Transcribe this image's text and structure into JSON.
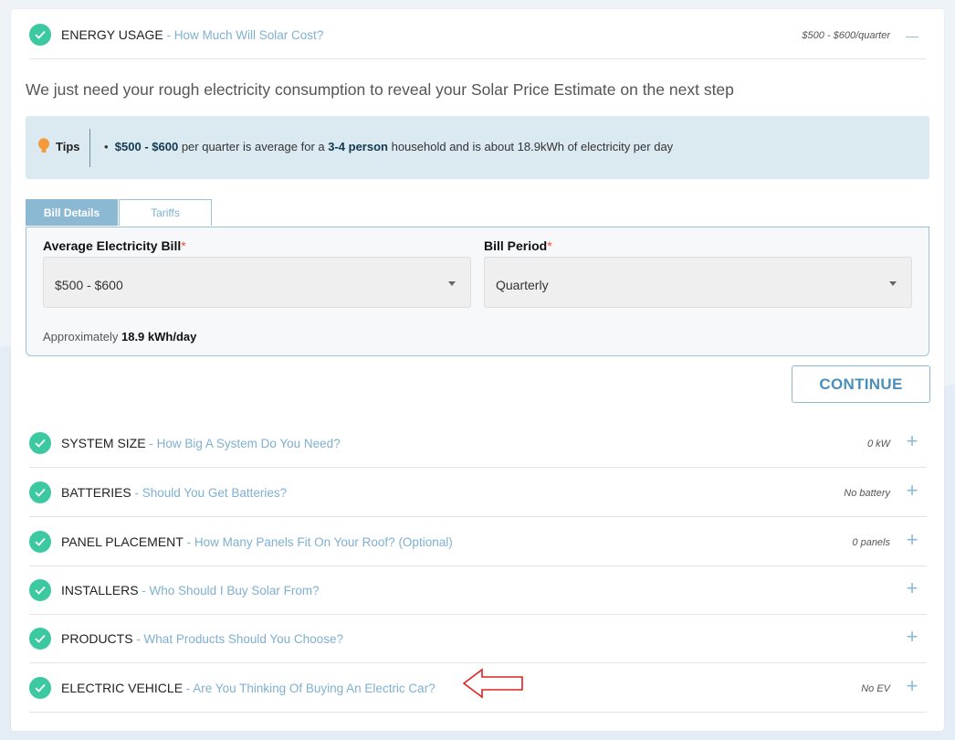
{
  "energy": {
    "title": "ENERGY USAGE",
    "subtitle": " - How Much Will Solar Cost?",
    "value": "$500 - $600/quarter",
    "toggle": "—",
    "intro": "We just need your rough electricity consumption to reveal your Solar Price Estimate on the next step"
  },
  "tips": {
    "label": "Tips",
    "bullet": "•",
    "price": "$500 - $600",
    "text_1": " per quarter is average for a ",
    "household": "3-4 person",
    "text_2": " household and is about 18.9kWh of electricity per day"
  },
  "tabs": [
    {
      "label": "Bill Details"
    },
    {
      "label": "Tariffs"
    }
  ],
  "form": {
    "bill_label": "Average Electricity Bill",
    "bill_value": "$500 - $600",
    "period_label": "Bill Period",
    "period_value": "Quarterly",
    "required_mark": "*",
    "approx_prefix": "Approximately ",
    "approx_value": "18.9 kWh/day"
  },
  "continue_label": "CONTINUE",
  "sections": [
    {
      "title": "SYSTEM SIZE",
      "subtitle": " - How Big A System Do You Need?",
      "value": "0 kW",
      "toggle": "+"
    },
    {
      "title": "BATTERIES",
      "subtitle": " - Should You Get Batteries?",
      "value": "No battery",
      "toggle": "+"
    },
    {
      "title": "PANEL PLACEMENT",
      "subtitle": " - How Many Panels Fit On Your Roof? (Optional)",
      "value": "0 panels",
      "toggle": "+"
    },
    {
      "title": "INSTALLERS",
      "subtitle": " - Who Should I Buy Solar From?",
      "value": "",
      "toggle": "+"
    },
    {
      "title": "PRODUCTS",
      "subtitle": " - What Products Should You Choose?",
      "value": "",
      "toggle": "+"
    },
    {
      "title": "ELECTRIC VEHICLE",
      "subtitle": " - Are You Thinking Of Buying An Electric Car?",
      "value": "No EV",
      "toggle": "+"
    }
  ],
  "colors": {
    "check_green": "#3cc9a2",
    "accent_blue": "#7fb0d0",
    "tab_active": "#8bb8d3",
    "required": "#e5533c",
    "arrow_red": "#e02020"
  },
  "icons": {
    "check": "check-icon",
    "bulb": "lightbulb-icon",
    "caret": "caret-down-icon",
    "arrow": "arrow-left-icon"
  }
}
